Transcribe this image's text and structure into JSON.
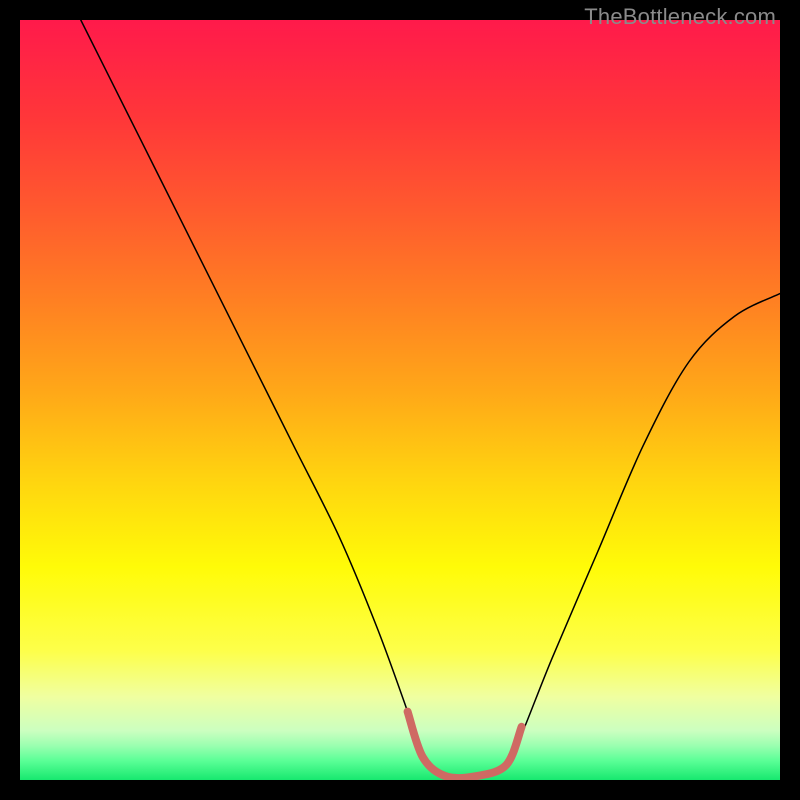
{
  "watermark": {
    "text": "TheBottleneck.com"
  },
  "chart_data": {
    "type": "line",
    "title": "",
    "xlabel": "",
    "ylabel": "",
    "xlim": [
      0,
      100
    ],
    "ylim": [
      0,
      100
    ],
    "grid": false,
    "legend": false,
    "series": [
      {
        "name": "main-curve",
        "color": "#000000",
        "stroke_width": 1.5,
        "x": [
          8,
          12,
          18,
          24,
          30,
          36,
          42,
          47,
          51,
          53,
          56,
          60,
          64,
          66,
          70,
          76,
          82,
          88,
          94,
          100
        ],
        "y": [
          100,
          92,
          80,
          68,
          56,
          44,
          32,
          20,
          9,
          3,
          0.5,
          0.5,
          2,
          6,
          16,
          30,
          44,
          55,
          61,
          64
        ]
      },
      {
        "name": "valley-band",
        "color": "#cf6a63",
        "stroke_width": 8,
        "x": [
          51,
          53,
          56,
          60,
          64,
          66
        ],
        "y": [
          9,
          3,
          0.5,
          0.5,
          2,
          7
        ]
      }
    ],
    "background_gradient": {
      "type": "vertical",
      "stops": [
        {
          "offset": 0.0,
          "color": "#ff1a4b"
        },
        {
          "offset": 0.13,
          "color": "#ff3739"
        },
        {
          "offset": 0.25,
          "color": "#ff5a2e"
        },
        {
          "offset": 0.37,
          "color": "#ff8022"
        },
        {
          "offset": 0.49,
          "color": "#ffa818"
        },
        {
          "offset": 0.61,
          "color": "#ffd60f"
        },
        {
          "offset": 0.72,
          "color": "#fffb08"
        },
        {
          "offset": 0.83,
          "color": "#fdff4a"
        },
        {
          "offset": 0.89,
          "color": "#f0ffa0"
        },
        {
          "offset": 0.935,
          "color": "#ccffc0"
        },
        {
          "offset": 0.955,
          "color": "#9affb0"
        },
        {
          "offset": 0.975,
          "color": "#5aff96"
        },
        {
          "offset": 1.0,
          "color": "#17e86f"
        }
      ]
    }
  }
}
